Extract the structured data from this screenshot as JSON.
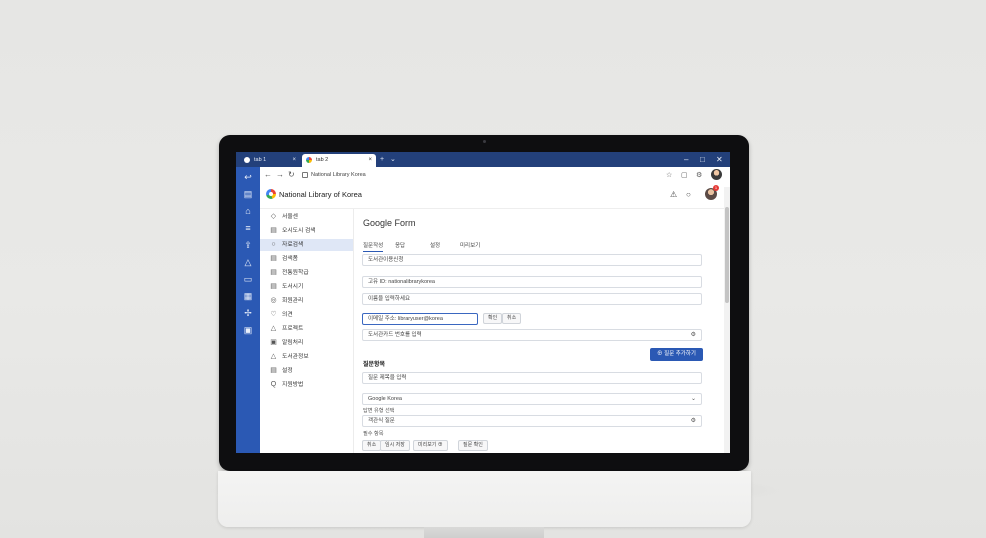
{
  "browser": {
    "tabs": [
      {
        "label": "tab 1",
        "active": false
      },
      {
        "label": "tab 2",
        "active": true
      }
    ],
    "new_tab_symbol": "+",
    "tab_menu_symbol": "⌄",
    "window_controls": {
      "minimize": "–",
      "maximize": "□",
      "close": "✕"
    },
    "url": "National Library Korea",
    "nav": {
      "back": "←",
      "forward": "→",
      "reload": "↻"
    }
  },
  "app_sidebar_icons": [
    "back-arrow-icon",
    "document-icon",
    "home-icon",
    "list-icon",
    "upload-icon",
    "alert-icon",
    "chat-icon",
    "grid-icon",
    "settings-icon",
    "panel-icon"
  ],
  "header": {
    "title": "National Library of Korea",
    "notification_count": "1"
  },
  "left_nav": {
    "items": [
      {
        "label": "서울센",
        "icon": "◇"
      },
      {
        "label": "오시도시 검색",
        "icon": "▤"
      },
      {
        "label": "자료검색",
        "icon": "○"
      },
      {
        "label": "검색폼",
        "icon": "▤"
      },
      {
        "label": "전통원학급",
        "icon": "▤"
      },
      {
        "label": "도서시기",
        "icon": "▤"
      },
      {
        "label": "회원관리",
        "icon": "◎"
      },
      {
        "label": "의견",
        "icon": "♡"
      },
      {
        "label": "프로젝트",
        "icon": "△"
      },
      {
        "label": "알림처리",
        "icon": "▣"
      },
      {
        "label": "도서관정보",
        "icon": "△"
      },
      {
        "label": "설정",
        "icon": "▤"
      },
      {
        "label": "지원방법",
        "icon": "Q"
      }
    ],
    "active_index": 2
  },
  "form": {
    "title": "Google Form",
    "tabs": [
      "질문작성",
      "응답",
      "설정",
      "미리보기"
    ],
    "active_tab": 0,
    "fields": [
      {
        "value": "도서관이용신청"
      },
      {
        "value": "고유 ID: nationalibrarykorea"
      },
      {
        "value": "이름을 입력하세요"
      },
      {
        "value": "이메일 주소: libraryuser@korea"
      },
      {
        "value": "도서관카드 번호를 입력"
      }
    ],
    "field4_buttons": [
      "확인",
      "취소"
    ],
    "primary_button": "질문 추가하기",
    "section_title": "질문항목",
    "section_fields": [
      {
        "value": "질문 제목을 입력"
      },
      {
        "value": "Google Korea",
        "type": "select"
      }
    ],
    "label_1": "답변 유형 선택",
    "label_2": "필수 항목",
    "select_field": "객관식 질문",
    "bottom_chips": [
      "취소",
      "임시 저장",
      "미리보기 ⊕",
      "질문 확인"
    ]
  }
}
